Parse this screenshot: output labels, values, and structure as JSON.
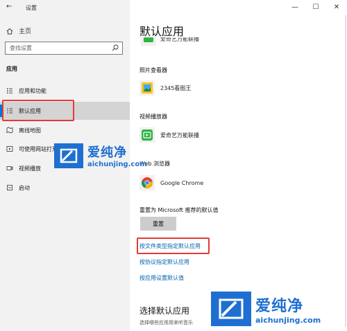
{
  "window": {
    "title": "设置",
    "controls": {
      "minimize": "—",
      "maximize": "☐",
      "close": "✕"
    }
  },
  "sidebar": {
    "home_label": "主页",
    "search_placeholder": "查找设置",
    "section_title": "应用",
    "items": [
      {
        "label": "应用和功能",
        "icon": "list-icon"
      },
      {
        "label": "默认应用",
        "icon": "default-apps-icon",
        "selected": true
      },
      {
        "label": "离线地图",
        "icon": "map-icon"
      },
      {
        "label": "可使用网站打开的应用",
        "icon": "website-app-icon"
      },
      {
        "label": "视频播放",
        "icon": "video-icon"
      },
      {
        "label": "启动",
        "icon": "startup-icon"
      }
    ]
  },
  "main": {
    "title": "默认应用",
    "partial_app_name": "爱奇艺万能联播",
    "categories": [
      {
        "label": "照片查看器",
        "app": "2345看图王",
        "icon": "photo-viewer-app-icon"
      },
      {
        "label": "视频播放器",
        "app": "爱奇艺万能联播",
        "icon": "video-player-app-icon"
      },
      {
        "label": "Web 浏览器",
        "app": "Google Chrome",
        "icon": "chrome-icon"
      }
    ],
    "reset_label": "重置为 Microsoft 推荐的默认值",
    "reset_button": "重置",
    "links": [
      "按文件类型指定默认应用",
      "按协议指定默认应用",
      "按应用设置默认值"
    ],
    "choose_title": "选择默认应用",
    "choose_desc": "选择哪些应用用来听音乐"
  },
  "watermark": {
    "cn": "爱纯净",
    "en": "aichunjing.com"
  },
  "colors": {
    "accent": "#0078d7",
    "link": "#0063b1",
    "highlight_box": "#e53935",
    "watermark": "#1e6fd1"
  }
}
